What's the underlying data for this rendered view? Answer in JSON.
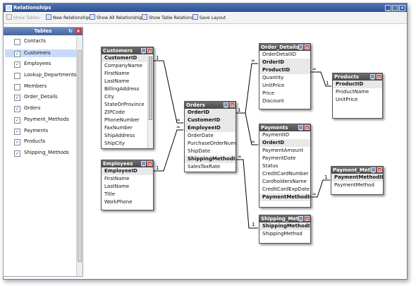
{
  "window": {
    "title": "Relationships"
  },
  "toolbar": {
    "show_tables": "Show Tables",
    "new_relationship": "New Relationship",
    "show_all_relationships": "Show All Relationships",
    "show_table_relations": "Show Table Relations",
    "save_layout": "Save Layout"
  },
  "sidebar": {
    "title": "Tables",
    "items": [
      {
        "label": "Contacts",
        "checked": false
      },
      {
        "label": "Customers",
        "checked": true
      },
      {
        "label": "Employees",
        "checked": true
      },
      {
        "label": "Lookup_Departments",
        "checked": false
      },
      {
        "label": "Members",
        "checked": false
      },
      {
        "label": "Order_Details",
        "checked": true
      },
      {
        "label": "Orders",
        "checked": true
      },
      {
        "label": "Payment_Methods",
        "checked": true
      },
      {
        "label": "Payments",
        "checked": true
      },
      {
        "label": "Products",
        "checked": true
      },
      {
        "label": "Shipping_Methods",
        "checked": true
      }
    ]
  },
  "tables": {
    "customers": {
      "title": "Customers",
      "fields": [
        "CustomerID",
        "CompanyName",
        "FirstName",
        "LastName",
        "BillingAddress",
        "City",
        "StateOrProvince",
        "ZIPCode",
        "PhoneNumber",
        "FaxNumber",
        "ShipAddress",
        "ShipCity"
      ]
    },
    "employees": {
      "title": "Employees",
      "fields": [
        "EmployeeID",
        "FirstName",
        "LastName",
        "Title",
        "WorkPhone"
      ]
    },
    "orders": {
      "title": "Orders",
      "fields": [
        "OrderID",
        "CustomerID",
        "EmployeeID",
        "OrderDate",
        "PurchaseOrderNumb",
        "ShipDate",
        "ShippingMethodID",
        "SalesTaxRate"
      ]
    },
    "order_details": {
      "title": "Order_Details",
      "fields": [
        "OrderDetailID",
        "OrderID",
        "ProductID",
        "Quantity",
        "UnitPrice",
        "Price",
        "Discount"
      ]
    },
    "products": {
      "title": "Products",
      "fields": [
        "ProductID",
        "ProductName",
        "UnitPrice"
      ]
    },
    "payments": {
      "title": "Payments",
      "fields": [
        "PaymentID",
        "OrderID",
        "PaymentAmount",
        "PaymentDate",
        "Status",
        "CreditCardNumber",
        "CardholdersName",
        "CreditCardExpDate",
        "PaymentMethodID"
      ]
    },
    "payment_methods": {
      "title": "Payment_Meth",
      "fields": [
        "PaymentMethodID",
        "PaymentMethod"
      ]
    },
    "shipping_methods": {
      "title": "Shipping_Meth",
      "fields": [
        "ShippingMethodID",
        "ShippingMethod"
      ]
    }
  },
  "relation_labels": {
    "one": "1",
    "many": "∞"
  }
}
